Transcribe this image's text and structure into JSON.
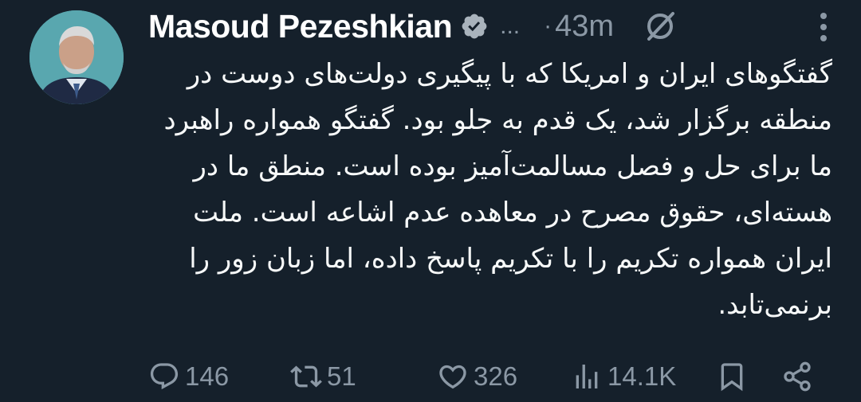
{
  "author": {
    "name": "Masoud Pezeshkian",
    "verified_icon": "verified-badge-icon",
    "handle_truncated": "...",
    "separator": "·",
    "time": "43m"
  },
  "tweet": {
    "text": "گفتگوهای ایران و امریکا که با پیگیری دولت‌های دوست در منطقه برگزار شد، یک قدم به جلو بود. گفتگو همواره راهبرد ما برای حل و فصل مسالمت‌آمیز بوده است. منطق ما در هسته‌ای، حقوق مصرح در معاهده عدم اشاعه است. ملت ایران همواره تکریم را با تکریم پاسخ داده، اما زبان زور را برنمی‌تابد."
  },
  "actions": {
    "replies": "146",
    "retweets": "51",
    "likes": "326",
    "views": "14.1K"
  },
  "colors": {
    "background": "#15202b",
    "text": "#f7f9f9",
    "muted": "#8b98a5",
    "verified_badge": "#a9b3bc"
  }
}
